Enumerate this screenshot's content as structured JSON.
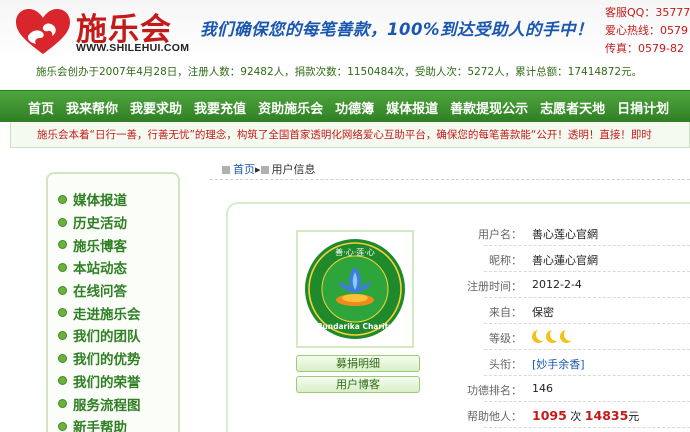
{
  "header": {
    "site_name": "施乐会",
    "site_url": "WWW.SHILEHUI.COM",
    "slogan": "我们确保您的每笔善款，100%到达受助人的手中！",
    "contacts": [
      "客服QQ：35777",
      "爱心热线：0579",
      "传真：0579-82"
    ]
  },
  "stats": {
    "text": "施乐会创办于2007年4月28日，注册人数：92482人，捐款次数：1150484次，受助人次：5272人，累计总额：17414872元。"
  },
  "nav": {
    "items": [
      "首页",
      "我来帮你",
      "我要求助",
      "我要充值",
      "资助施乐会",
      "功德簿",
      "媒体报道",
      "善款提现公示",
      "志愿者天地",
      "日捐计划"
    ]
  },
  "notice": {
    "text": "施乐会本着“日行一善，行善无忧”的理念，构筑了全国首家透明化网络爱心互助平台，确保您的每笔善款能“公开！透明！直接！即时"
  },
  "sidebar": {
    "items": [
      "媒体报道",
      "历史活动",
      "施乐博客",
      "本站动态",
      "在线问答",
      "走进施乐会",
      "我们的团队",
      "我们的优势",
      "我们的荣誉",
      "服务流程图",
      "新手帮助"
    ]
  },
  "breadcrumb": {
    "home": "首页",
    "current": "用户信息"
  },
  "profile": {
    "avatar_top_text": "善·心·莲·心",
    "avatar_bottom_text": "Pundarika Charity",
    "buttons": {
      "donation_detail": "募捐明细",
      "user_blog": "用户博客"
    },
    "fields": {
      "username_label": "用户名：",
      "username": "善心莲心官網",
      "nickname_label": "昵称：",
      "nickname": "善心蓮心官網",
      "reg_time_label": "注册时间：",
      "reg_time": "2012-2-4",
      "origin_label": "来自：",
      "origin": "保密",
      "level_label": "等级：",
      "title_label": "头衔：",
      "title": "[妙手余香]",
      "merit_rank_label": "功德排名：",
      "merit_rank": "146",
      "help_label": "帮助他人：",
      "help_times": "1095",
      "help_times_unit": "次",
      "help_amount": "14835",
      "help_amount_unit": "元"
    },
    "level_moons": 3
  },
  "colors": {
    "brand_red": "#c41a1a",
    "nav_green": "#2f7f24",
    "link_blue": "#1a57b0",
    "moon_gold": "#f2c21a"
  }
}
